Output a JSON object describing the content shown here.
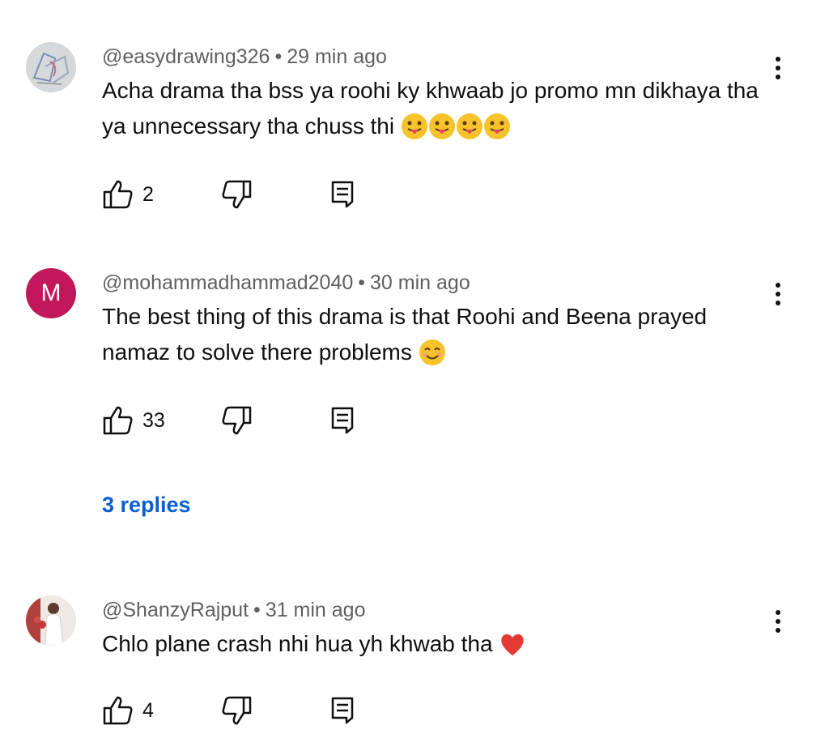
{
  "comments": [
    {
      "author": "@easydrawing326",
      "time": "29 min ago",
      "text": "Acha drama tha bss ya roohi ky khwaab jo promo mn dikhaya tha ya unnecessary tha chuss thi",
      "emoji": [
        "face-with-tongue-emoji",
        "face-with-tongue-emoji",
        "face-with-tongue-emoji",
        "face-with-tongue-emoji"
      ],
      "likes": "2",
      "avatar": "drawing-avatar"
    },
    {
      "author": "@mohammadhammad2040",
      "time": "30 min ago",
      "text": "The best thing of this drama is that Roohi and Beena prayed namaz to solve there problems",
      "emoji": [
        "smiling-face-emoji"
      ],
      "likes": "33",
      "avatar_letter": "M",
      "avatar_color": "#c2185b"
    },
    {
      "author": "@ShanzyRajput",
      "time": "31 min ago",
      "text": "Chlo plane crash nhi hua yh khwab tha",
      "emoji": [
        "red-heart-emoji"
      ],
      "likes": "4",
      "avatar": "photo-avatar"
    }
  ],
  "replies_label": "3 replies",
  "separator": "•",
  "colors": {
    "link": "#065fd4",
    "meta": "#606060",
    "text": "#0f0f0f"
  }
}
